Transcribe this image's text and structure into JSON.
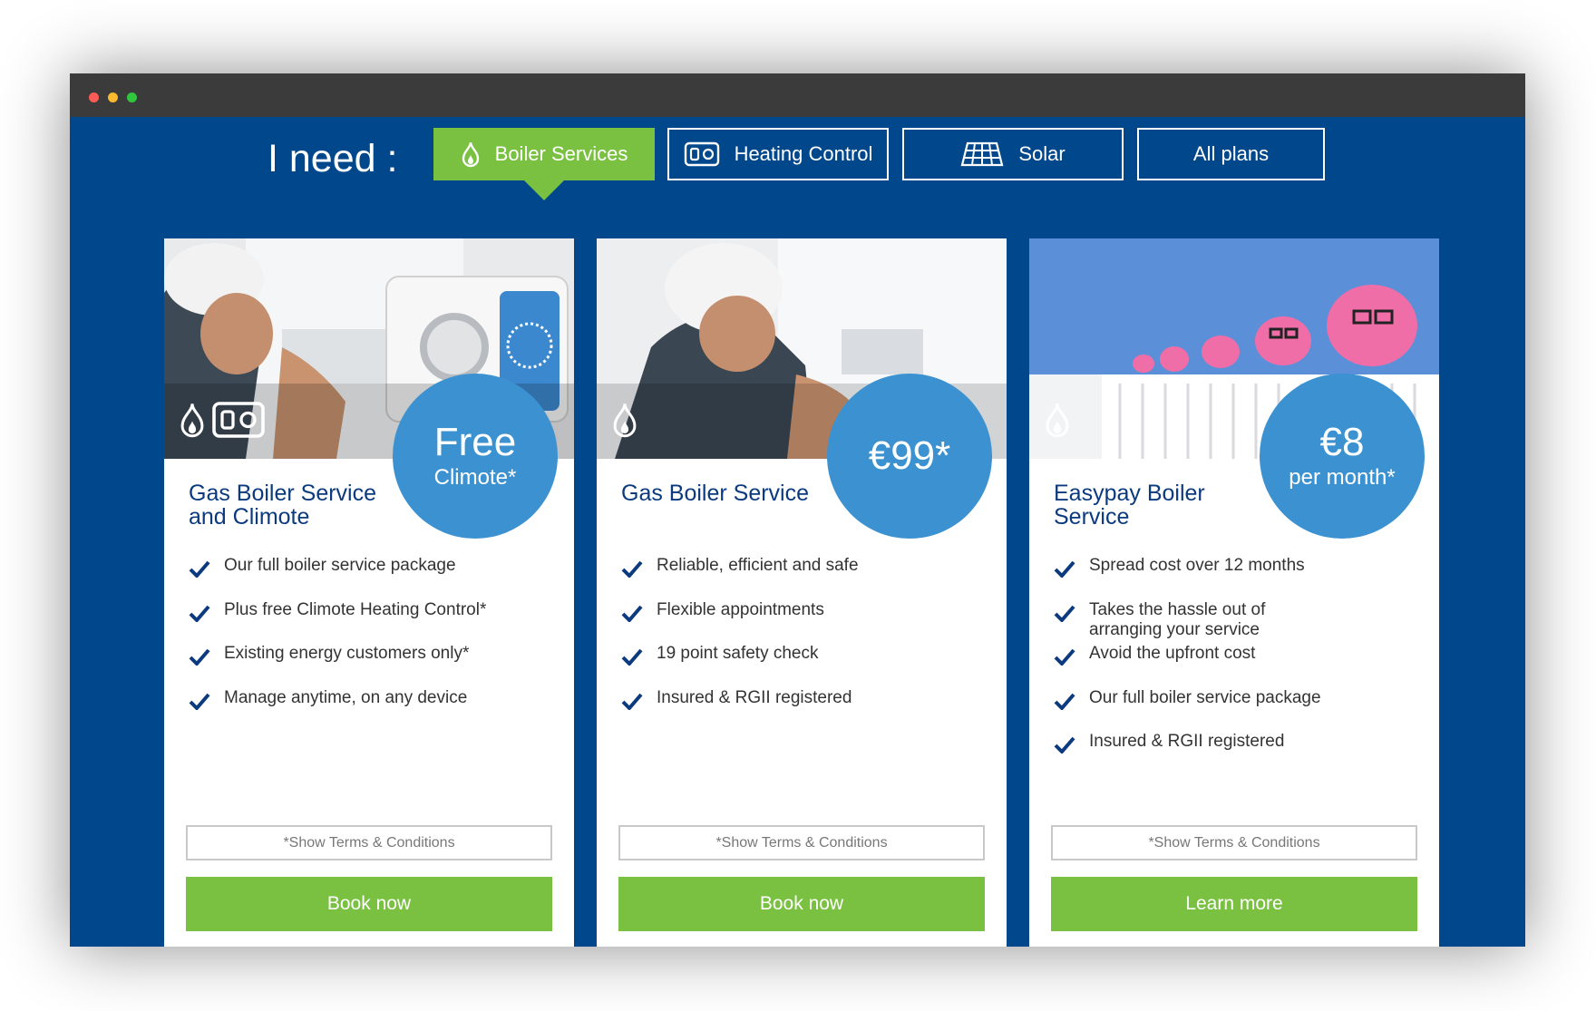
{
  "colors": {
    "page_background": "#00478c",
    "accent_green": "#7ac142",
    "price_blue": "#3c92d0",
    "title_blue": "#0b3a7e"
  },
  "header": {
    "label": "I need :",
    "tabs": [
      {
        "label": "Boiler Services",
        "icon": "flame-icon",
        "active": true
      },
      {
        "label": "Heating Control",
        "icon": "thermostat-control-icon",
        "active": false
      },
      {
        "label": "Solar",
        "icon": "solar-panel-icon",
        "active": false
      },
      {
        "label": "All plans",
        "icon": "",
        "active": false
      }
    ]
  },
  "cards": [
    {
      "image": "engineer servicing boiler with thermostat device",
      "image_icons": [
        "flame-icon",
        "thermostat-control-icon"
      ],
      "price_main": "Free",
      "price_sub": "Climote*",
      "title": "Gas Boiler Service and Climote",
      "features": [
        "Our full boiler service package",
        "Plus free Climote Heating Control*",
        "Existing energy customers only*",
        "Manage anytime, on any device"
      ],
      "terms_label": "*Show Terms & Conditions",
      "action_label": "Book now"
    },
    {
      "image": "engineer servicing boiler",
      "image_icons": [
        "flame-icon"
      ],
      "price_main": "€99*",
      "price_sub": "",
      "title": "Gas Boiler Service",
      "features": [
        "Reliable, efficient and safe",
        "Flexible appointments",
        "19 point safety check",
        "Insured & RGII registered"
      ],
      "terms_label": "*Show Terms & Conditions",
      "action_label": "Book now"
    },
    {
      "image": "pink piggy banks on radiator",
      "image_icons": [
        "flame-icon"
      ],
      "price_main": "€8",
      "price_sub": "per month*",
      "title": "Easypay Boiler Service",
      "features": [
        "Spread cost over 12 months",
        "Takes the hassle out of arranging your service",
        "Avoid the upfront cost",
        "Our full boiler service package",
        "Insured & RGII registered"
      ],
      "terms_label": "*Show Terms & Conditions",
      "action_label": "Learn more"
    }
  ]
}
